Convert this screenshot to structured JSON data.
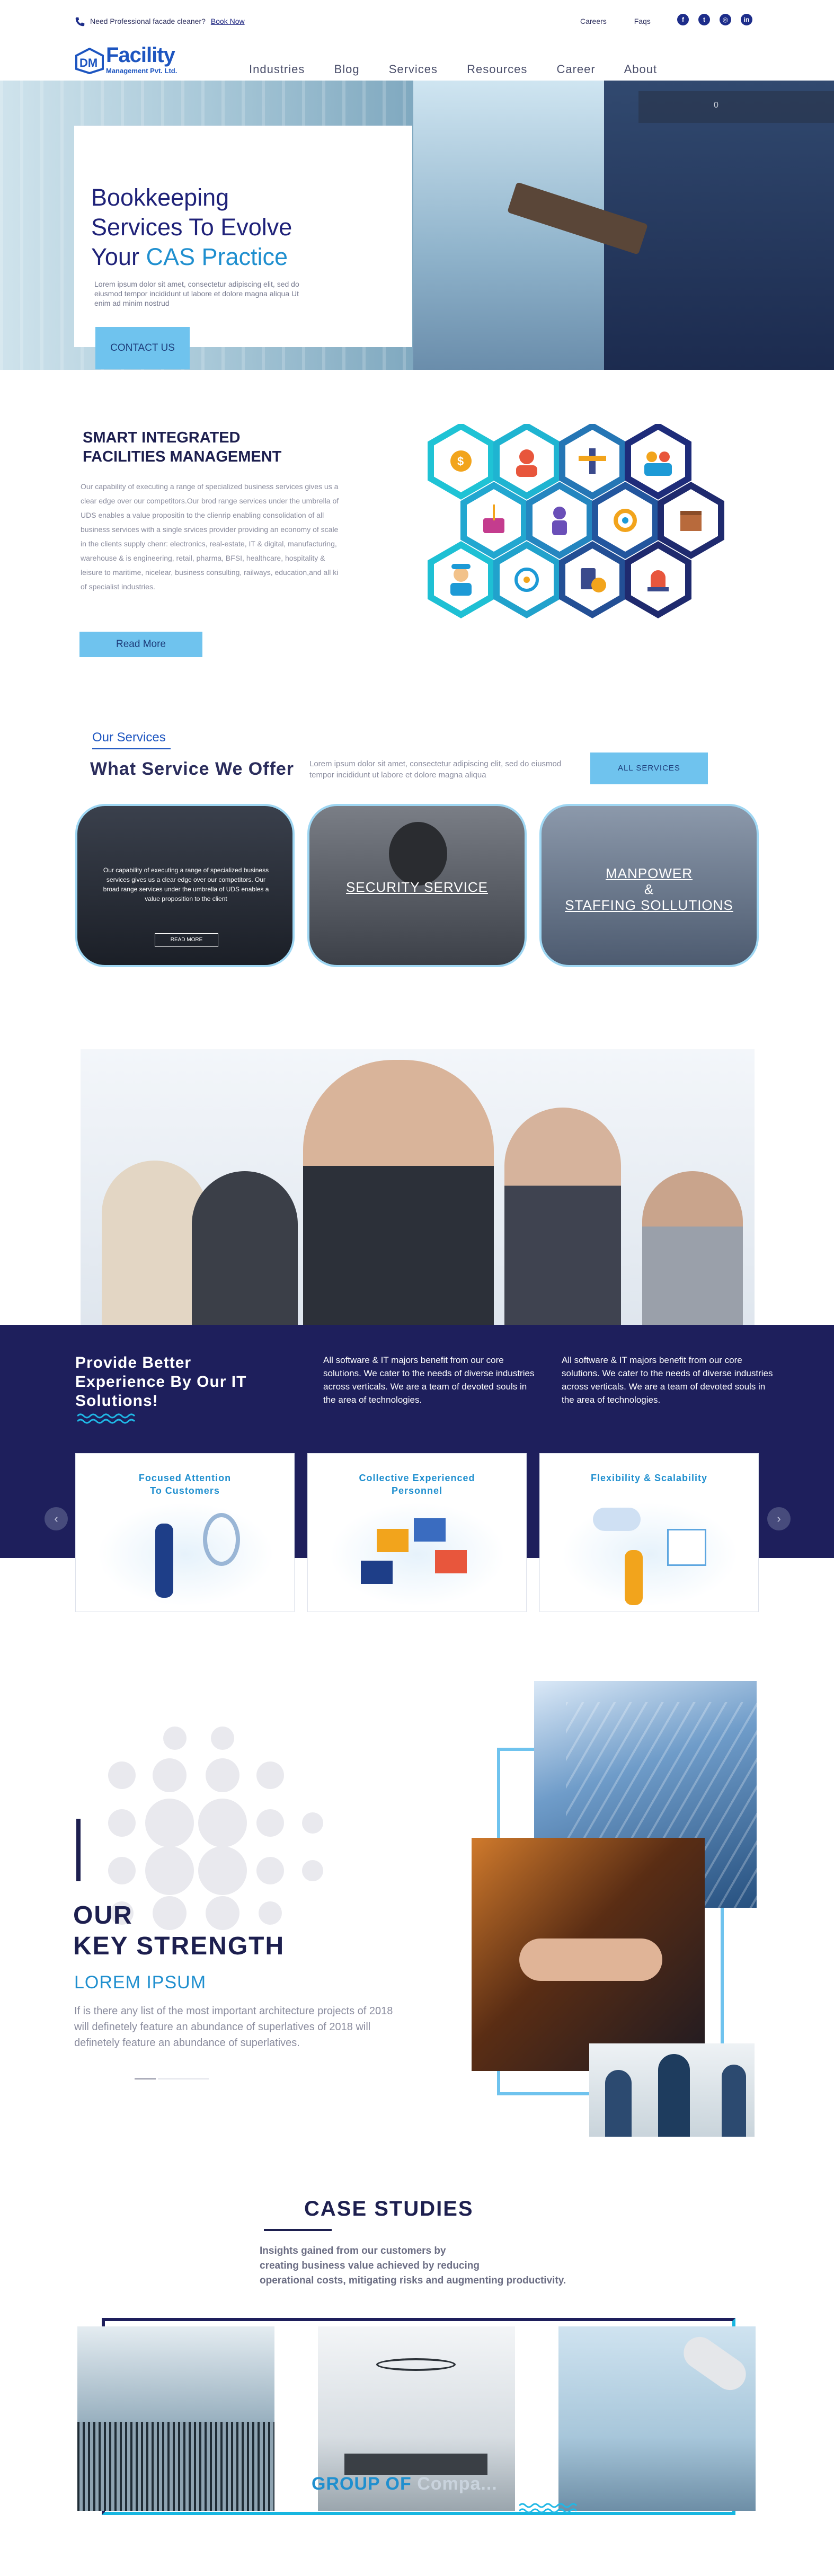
{
  "topbar": {
    "promo_text": "Need Professional facade cleaner?",
    "promo_link": "Book Now",
    "links": [
      "Careers",
      "Faqs"
    ],
    "social_icons": [
      "facebook-icon",
      "twitter-icon",
      "instagram-icon",
      "linkedin-icon"
    ]
  },
  "logo": {
    "name": "Facility",
    "subtitle": "Management Pvt. Ltd."
  },
  "nav": [
    "Industries",
    "Blog",
    "Services",
    "Resources",
    "Career",
    "About"
  ],
  "hero": {
    "title_line1": "Bookkeeping",
    "title_line2": "Services To Evolve",
    "title_line3_a": "Your",
    "title_line3_b": "CAS Practice",
    "body": "Lorem ipsum dolor sit amet, consectetur adipiscing elit, sed do eiusmod tempor incididunt ut labore et dolore magna aliqua Ut enim ad minim nostrud",
    "cta": "CONTACT US",
    "slide_indicator": "0"
  },
  "facilities": {
    "title_line1": "SMART INTEGRATED",
    "title_line2": "FACILITIES MANAGEMENT",
    "body": "Our capability of executing a range of specialized business services gives us a clear edge over our competitors.Our brod range services under the umbrella of UDS enables a value propositin to the clienrip enabling consolidation of all business services with a single srvices provider providing an economy of scale in the clients supply chenr: electronics, real-estate, IT & digital, manufacturing, warehouse & is engineering, retail, pharma, BFSI, healthcare, hospitality & leisure to maritime, nicelear, business consulting, railways, education,and all ki of specialist industries.",
    "button": "Read More"
  },
  "services": {
    "kicker": "Our Services",
    "title": "What Service We Offer",
    "desc": "Lorem ipsum dolor sit amet, consectetur adipiscing elit, sed do eiusmod tempor incididunt ut labore et dolore magna aliqua",
    "button": "ALL SERVICES",
    "card1_text": "Our capability of executing a range of specialized business services gives us a clear edge over our competitors. Our broad range services under the umbrella of UDS enables a value proposition to the client",
    "card1_button": "READ MORE",
    "card2_label": "SECURITY SERVICE",
    "card3_label_a": "MANPOWER",
    "card3_label_b": "&",
    "card3_label_c": "STAFFING SOLLUTIONS"
  },
  "it": {
    "title_line1": "Provide Better",
    "title_line2": "Experience By Our IT",
    "title_line3": "Solutions!",
    "text1": "All software & IT majors benefit from our core solutions. We cater to the needs of diverse industries across verticals. We are a team of devoted souls in the area of technologies.",
    "text2": "All software & IT majors benefit from our core solutions. We cater to the needs of diverse industries across verticals. We are a team of devoted souls in the area of technologies.",
    "cards": [
      {
        "l1": "Focused Attention",
        "l2": "To Customers"
      },
      {
        "l1": "Collective Experienced",
        "l2": "Personnel"
      },
      {
        "l1": "Flexibility & Scalability",
        "l2": ""
      }
    ],
    "prev": "‹",
    "next": "›"
  },
  "strength": {
    "title_line1": "OUR",
    "title_line2": "KEY STRENGTH",
    "lorem": "LOREM IPSUM",
    "text": "If is there any list of the most important architecture projects of 2018 will definetely feature an abundance of superlatives of 2018 will definetely feature an abundance of superlatives."
  },
  "cases": {
    "title": "CASE STUDIES",
    "text_line1": "Insights gained from our customers by",
    "text_line2": "creating business value achieved by reducing",
    "text_line3": "operational costs, mitigating risks and augmenting productivity.",
    "group_a": "GROUP OF",
    "group_b": "Compa..."
  },
  "colors": {
    "navy": "#1e1f5c",
    "accent_blue": "#1f8fcf",
    "button_blue": "#6fc3ee",
    "cyan": "#17b6e0"
  }
}
